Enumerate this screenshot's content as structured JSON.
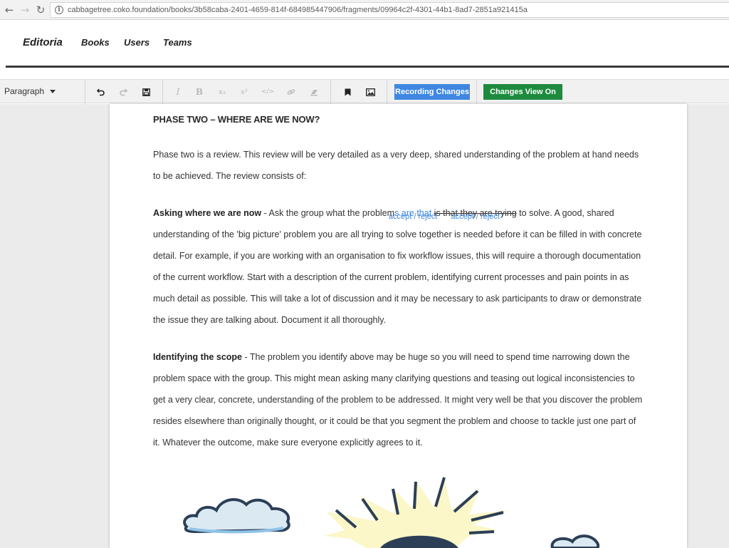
{
  "browser": {
    "url": "cabbagetree.coko.foundation/books/3b58caba-2401-4659-814f-684985447906/fragments/09964c2f-4301-44b1-8ad7-2851a921415a"
  },
  "header": {
    "brand": "Editoria",
    "nav": [
      "Books",
      "Users",
      "Teams"
    ]
  },
  "toolbar": {
    "block_type": "Paragraph",
    "recording_label": "Recording Changes",
    "view_label": "Changes View On",
    "recording_color": "#3f87e0",
    "view_color": "#1e8a3e"
  },
  "document": {
    "heading": "PHASE TWO – WHERE ARE WE NOW?",
    "p1": "Phase two is a review. This review will be very detailed as a very deep, shared understanding of the problem at hand needs to be achieved. The review consists of:",
    "p2": {
      "bold": "Asking where we are now",
      "pre": " - Ask the group what the problem",
      "inserted": "s are that ",
      "gap": " ",
      "deleted": "is that they are trying",
      "post": " to solve. A good, shared understanding of the 'big picture' problem you are all trying to solve together is needed before it can be filled in with concrete detail. For example, if you are working with an organisation to fix workflow issues, this will require a thorough documentation of the current workflow. Start with a description of the current problem, identifying current processes and pain points in as much detail as possible. This will take a lot of discussion and it may be necessary to ask participants to draw or demonstrate the issue they are talking about. Document it all thoroughly.",
      "accept_reject": "accept / reject"
    },
    "p3": {
      "bold": "Identifying the scope",
      "text": " - The problem you identify above may be huge so you will need to spend time narrowing down the problem space with the group. This might mean asking many clarifying questions and teasing out logical inconsistencies to get a very clear, concrete, understanding of the problem to be addressed. It might very well be that you discover the problem resides elsewhere than originally thought, or it could be that you segment the problem and choose to tackle just one part of it. Whatever the outcome, make sure everyone explicitly agrees to it."
    }
  }
}
